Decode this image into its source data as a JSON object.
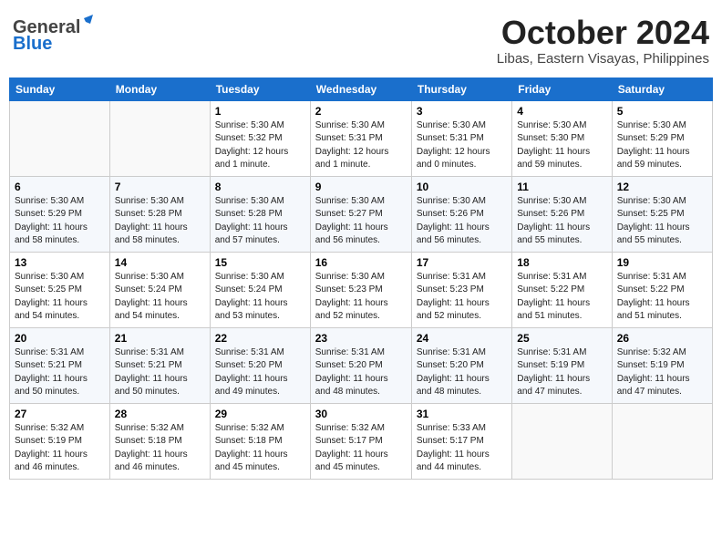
{
  "header": {
    "logo_general": "General",
    "logo_blue": "Blue",
    "month": "October 2024",
    "location": "Libas, Eastern Visayas, Philippines"
  },
  "days_of_week": [
    "Sunday",
    "Monday",
    "Tuesday",
    "Wednesday",
    "Thursday",
    "Friday",
    "Saturday"
  ],
  "weeks": [
    [
      {
        "day": "",
        "info": ""
      },
      {
        "day": "",
        "info": ""
      },
      {
        "day": "1",
        "info": "Sunrise: 5:30 AM\nSunset: 5:32 PM\nDaylight: 12 hours\nand 1 minute."
      },
      {
        "day": "2",
        "info": "Sunrise: 5:30 AM\nSunset: 5:31 PM\nDaylight: 12 hours\nand 1 minute."
      },
      {
        "day": "3",
        "info": "Sunrise: 5:30 AM\nSunset: 5:31 PM\nDaylight: 12 hours\nand 0 minutes."
      },
      {
        "day": "4",
        "info": "Sunrise: 5:30 AM\nSunset: 5:30 PM\nDaylight: 11 hours\nand 59 minutes."
      },
      {
        "day": "5",
        "info": "Sunrise: 5:30 AM\nSunset: 5:29 PM\nDaylight: 11 hours\nand 59 minutes."
      }
    ],
    [
      {
        "day": "6",
        "info": "Sunrise: 5:30 AM\nSunset: 5:29 PM\nDaylight: 11 hours\nand 58 minutes."
      },
      {
        "day": "7",
        "info": "Sunrise: 5:30 AM\nSunset: 5:28 PM\nDaylight: 11 hours\nand 58 minutes."
      },
      {
        "day": "8",
        "info": "Sunrise: 5:30 AM\nSunset: 5:28 PM\nDaylight: 11 hours\nand 57 minutes."
      },
      {
        "day": "9",
        "info": "Sunrise: 5:30 AM\nSunset: 5:27 PM\nDaylight: 11 hours\nand 56 minutes."
      },
      {
        "day": "10",
        "info": "Sunrise: 5:30 AM\nSunset: 5:26 PM\nDaylight: 11 hours\nand 56 minutes."
      },
      {
        "day": "11",
        "info": "Sunrise: 5:30 AM\nSunset: 5:26 PM\nDaylight: 11 hours\nand 55 minutes."
      },
      {
        "day": "12",
        "info": "Sunrise: 5:30 AM\nSunset: 5:25 PM\nDaylight: 11 hours\nand 55 minutes."
      }
    ],
    [
      {
        "day": "13",
        "info": "Sunrise: 5:30 AM\nSunset: 5:25 PM\nDaylight: 11 hours\nand 54 minutes."
      },
      {
        "day": "14",
        "info": "Sunrise: 5:30 AM\nSunset: 5:24 PM\nDaylight: 11 hours\nand 54 minutes."
      },
      {
        "day": "15",
        "info": "Sunrise: 5:30 AM\nSunset: 5:24 PM\nDaylight: 11 hours\nand 53 minutes."
      },
      {
        "day": "16",
        "info": "Sunrise: 5:30 AM\nSunset: 5:23 PM\nDaylight: 11 hours\nand 52 minutes."
      },
      {
        "day": "17",
        "info": "Sunrise: 5:31 AM\nSunset: 5:23 PM\nDaylight: 11 hours\nand 52 minutes."
      },
      {
        "day": "18",
        "info": "Sunrise: 5:31 AM\nSunset: 5:22 PM\nDaylight: 11 hours\nand 51 minutes."
      },
      {
        "day": "19",
        "info": "Sunrise: 5:31 AM\nSunset: 5:22 PM\nDaylight: 11 hours\nand 51 minutes."
      }
    ],
    [
      {
        "day": "20",
        "info": "Sunrise: 5:31 AM\nSunset: 5:21 PM\nDaylight: 11 hours\nand 50 minutes."
      },
      {
        "day": "21",
        "info": "Sunrise: 5:31 AM\nSunset: 5:21 PM\nDaylight: 11 hours\nand 50 minutes."
      },
      {
        "day": "22",
        "info": "Sunrise: 5:31 AM\nSunset: 5:20 PM\nDaylight: 11 hours\nand 49 minutes."
      },
      {
        "day": "23",
        "info": "Sunrise: 5:31 AM\nSunset: 5:20 PM\nDaylight: 11 hours\nand 48 minutes."
      },
      {
        "day": "24",
        "info": "Sunrise: 5:31 AM\nSunset: 5:20 PM\nDaylight: 11 hours\nand 48 minutes."
      },
      {
        "day": "25",
        "info": "Sunrise: 5:31 AM\nSunset: 5:19 PM\nDaylight: 11 hours\nand 47 minutes."
      },
      {
        "day": "26",
        "info": "Sunrise: 5:32 AM\nSunset: 5:19 PM\nDaylight: 11 hours\nand 47 minutes."
      }
    ],
    [
      {
        "day": "27",
        "info": "Sunrise: 5:32 AM\nSunset: 5:19 PM\nDaylight: 11 hours\nand 46 minutes."
      },
      {
        "day": "28",
        "info": "Sunrise: 5:32 AM\nSunset: 5:18 PM\nDaylight: 11 hours\nand 46 minutes."
      },
      {
        "day": "29",
        "info": "Sunrise: 5:32 AM\nSunset: 5:18 PM\nDaylight: 11 hours\nand 45 minutes."
      },
      {
        "day": "30",
        "info": "Sunrise: 5:32 AM\nSunset: 5:17 PM\nDaylight: 11 hours\nand 45 minutes."
      },
      {
        "day": "31",
        "info": "Sunrise: 5:33 AM\nSunset: 5:17 PM\nDaylight: 11 hours\nand 44 minutes."
      },
      {
        "day": "",
        "info": ""
      },
      {
        "day": "",
        "info": ""
      }
    ]
  ]
}
